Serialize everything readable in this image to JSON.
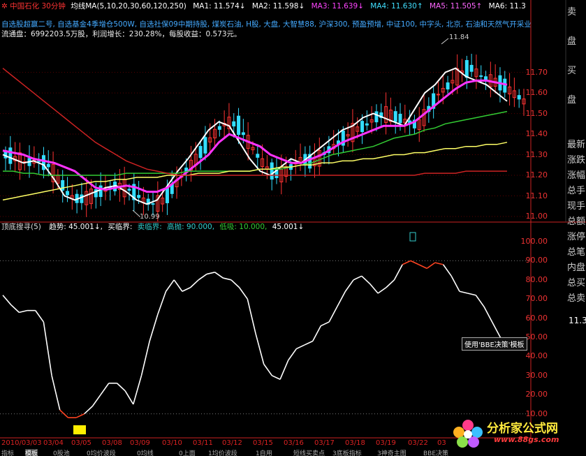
{
  "header": {
    "stock_name": "中国石化",
    "period": "30分钟",
    "ma_label": "均线MA(5,10,20,30,60,120,250)",
    "ma1": "MA1: 11.574↓",
    "ma2": "MA2: 11.598↓",
    "ma3": "MA3: 11.639↓",
    "ma4": "MA4: 11.630↑",
    "ma5": "MA5: 11.505↑",
    "ma6": "MA6: 11.3",
    "concepts": "自选股超赢二号, 自选基金4季增仓500W, 自选社保09中期持股, 煤炭石油, H股, 大盘, 大智慧88, 沪深300, 预盈预增, 中证100, 中字头, 北京, 石油和天然气开采业",
    "fundamentals": "流通盘：6992203.5万股，利润增长：230.28%，每股收益：0.573元。",
    "colors": {
      "stock_name": "#ff3333",
      "period": "#ff3333",
      "ma1": "#ffffff",
      "ma2": "#ffffff",
      "ma3": "#ff44ff",
      "ma4": "#40e0ff",
      "ma5": "#ff66ff",
      "ma6": "#ffffff",
      "concepts": "#44aaff"
    }
  },
  "price_axis": [
    "11.70",
    "11.60",
    "11.50",
    "11.40",
    "11.30",
    "11.20",
    "11.10",
    "11.00"
  ],
  "price_annotations": {
    "low": "10.99",
    "high": "11.84"
  },
  "indicator": {
    "name": "顶底搜寻(5)",
    "trend": "趋势: 45.001↓,",
    "buy": "买临界:",
    "sell": "卖临界:",
    "high": "高抛: 90.000,",
    "low": "低吸: 10.000,",
    "last": "45.001↓"
  },
  "indicator_axis": [
    "100.00",
    "90.00",
    "80.00",
    "70.00",
    "60.00",
    "50.00",
    "40.00",
    "30.00",
    "20.00",
    "10.00"
  ],
  "side_labels": [
    "卖",
    "盘",
    "买",
    "盘",
    "最新",
    "涨跌",
    "涨幅",
    "总手",
    "现手",
    "总额",
    "涨停",
    "总笔",
    "内盘",
    "总买",
    "总卖",
    "11.3"
  ],
  "dates": [
    "2010/03/03",
    "03/04",
    "03/05",
    "03/08",
    "03/09",
    "03/10",
    "03/11",
    "03/12",
    "03/15",
    "03/16",
    "03/17",
    "03/18",
    "03/19",
    "03/22",
    "03"
  ],
  "tabs": [
    "指标",
    "模板",
    "0股池",
    "0均价波段",
    "0均线",
    "0上面",
    "1均价波段",
    "1自用",
    "短线买卖点",
    "3底板指标",
    "3神奇主图",
    "BBE决策"
  ],
  "tooltip": "使用'BBE决策'模板",
  "logo": {
    "title": "分析家公式网",
    "url": "www.88gs.com"
  },
  "chart_data": [
    {
      "type": "line",
      "title": "",
      "series": [
        {
          "name": "MA1",
          "color": "#ffffff",
          "values": [
            11.3,
            11.28,
            11.26,
            11.27,
            11.25,
            11.18,
            11.1,
            11.08,
            11.1,
            11.12,
            11.14,
            11.15,
            11.12,
            11.08,
            11.06,
            11.08,
            11.15,
            11.22,
            11.28,
            11.35,
            11.42,
            11.46,
            11.44,
            11.36,
            11.28,
            11.22,
            11.2,
            11.24,
            11.28,
            11.26,
            11.3,
            11.34,
            11.38,
            11.42,
            11.44,
            11.48,
            11.5,
            11.48,
            11.46,
            11.44,
            11.52,
            11.6,
            11.64,
            11.7,
            11.72,
            11.68,
            11.66,
            11.64,
            11.6,
            11.56
          ]
        },
        {
          "name": "MA3",
          "color": "#ff33ff",
          "values": [
            11.32,
            11.31,
            11.3,
            11.28,
            11.27,
            11.26,
            11.24,
            11.22,
            11.18,
            11.14,
            11.13,
            11.14,
            11.15,
            11.14,
            11.12,
            11.12,
            11.14,
            11.18,
            11.22,
            11.26,
            11.3,
            11.36,
            11.4,
            11.38,
            11.36,
            11.34,
            11.3,
            11.28,
            11.26,
            11.26,
            11.28,
            11.3,
            11.33,
            11.36,
            11.38,
            11.4,
            11.42,
            11.44,
            11.44,
            11.44,
            11.46,
            11.5,
            11.54,
            11.58,
            11.62,
            11.65,
            11.66,
            11.66,
            11.65,
            11.64
          ]
        },
        {
          "name": "MA5",
          "color": "#33cc33",
          "values": [
            11.22,
            11.22,
            11.21,
            11.21,
            11.2,
            11.2,
            11.2,
            11.2,
            11.2,
            11.2,
            11.2,
            11.2,
            11.21,
            11.21,
            11.21,
            11.21,
            11.21,
            11.21,
            11.22,
            11.22,
            11.22,
            11.22,
            11.22,
            11.22,
            11.22,
            11.23,
            11.23,
            11.23,
            11.24,
            11.25,
            11.26,
            11.28,
            11.3,
            11.31,
            11.32,
            11.33,
            11.34,
            11.36,
            11.38,
            11.39,
            11.4,
            11.42,
            11.43,
            11.45,
            11.46,
            11.47,
            11.48,
            11.49,
            11.5,
            11.51
          ]
        },
        {
          "name": "MA6",
          "color": "#ffff66",
          "values": [
            11.08,
            11.09,
            11.1,
            11.11,
            11.12,
            11.13,
            11.14,
            11.15,
            11.16,
            11.17,
            11.17,
            11.18,
            11.18,
            11.19,
            11.19,
            11.19,
            11.2,
            11.2,
            11.2,
            11.21,
            11.21,
            11.21,
            11.22,
            11.22,
            11.22,
            11.23,
            11.23,
            11.24,
            11.24,
            11.25,
            11.25,
            11.26,
            11.26,
            11.27,
            11.27,
            11.28,
            11.28,
            11.29,
            11.3,
            11.3,
            11.31,
            11.31,
            11.32,
            11.33,
            11.33,
            11.34,
            11.34,
            11.35,
            11.35,
            11.36
          ]
        },
        {
          "name": "MA7",
          "color": "#cc2222",
          "values": [
            11.72,
            11.68,
            11.64,
            11.6,
            11.56,
            11.52,
            11.48,
            11.44,
            11.4,
            11.36,
            11.33,
            11.3,
            11.27,
            11.25,
            11.23,
            11.22,
            11.21,
            11.2,
            11.2,
            11.2,
            11.2,
            11.2,
            11.2,
            11.2,
            11.2,
            11.2,
            11.2,
            11.2,
            11.2,
            11.2,
            11.2,
            11.2,
            11.2,
            11.2,
            11.2,
            11.2,
            11.2,
            11.2,
            11.2,
            11.2,
            11.2,
            11.21,
            11.21,
            11.21,
            11.21,
            11.22,
            11.22,
            11.22,
            11.22,
            11.22
          ]
        }
      ],
      "ylim": [
        11.0,
        11.78
      ]
    },
    {
      "type": "line",
      "title": "",
      "series": [
        {
          "name": "趋势",
          "color": "#ffffff",
          "values": [
            72,
            67,
            63,
            64,
            64,
            58,
            30,
            12,
            8,
            8,
            10,
            14,
            20,
            26,
            26,
            22,
            15,
            30,
            48,
            62,
            74,
            80,
            74,
            76,
            80,
            83,
            84,
            81,
            80,
            76,
            70,
            52,
            36,
            30,
            28,
            38,
            44,
            46,
            48,
            56,
            58,
            66,
            74,
            80,
            82,
            78,
            73,
            76,
            80,
            88,
            90,
            88,
            86,
            89,
            88,
            82,
            74,
            73,
            72,
            66,
            58,
            50,
            45
          ]
        }
      ],
      "ylim": [
        0,
        100
      ]
    }
  ]
}
